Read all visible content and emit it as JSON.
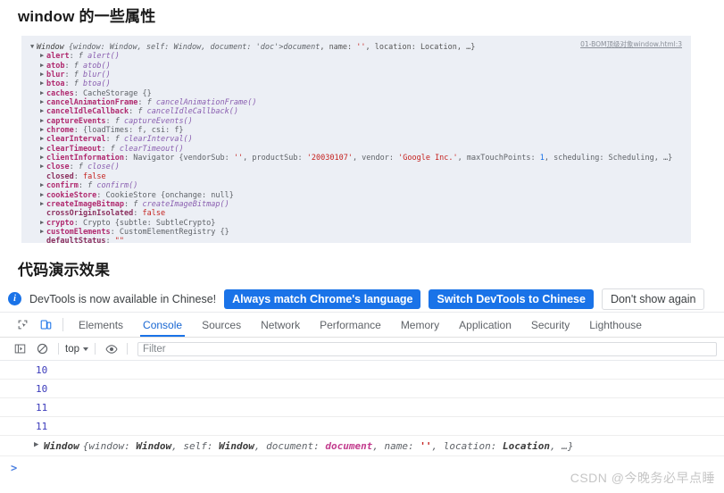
{
  "headings": {
    "first": "window 的一些属性",
    "second": "代码演示效果"
  },
  "log_block": {
    "source_link": "01-BOM顶级对象window.html:3",
    "header": {
      "ctor": "Window",
      "body": "{window: Window, self: Window, document: document, name: '', location: Location, …}"
    },
    "entries": [
      {
        "name": "alert",
        "value": "f alert()",
        "kind": "fn",
        "expandable": true
      },
      {
        "name": "atob",
        "value": "f atob()",
        "kind": "fn",
        "expandable": true
      },
      {
        "name": "blur",
        "value": "f blur()",
        "kind": "fn",
        "expandable": true
      },
      {
        "name": "btoa",
        "value": "f btoa()",
        "kind": "fn",
        "expandable": true
      },
      {
        "name": "caches",
        "value": "CacheStorage {}",
        "kind": "obj",
        "expandable": true
      },
      {
        "name": "cancelAnimationFrame",
        "value": "f cancelAnimationFrame()",
        "kind": "fn",
        "expandable": true
      },
      {
        "name": "cancelIdleCallback",
        "value": "f cancelIdleCallback()",
        "kind": "fn",
        "expandable": true
      },
      {
        "name": "captureEvents",
        "value": "f captureEvents()",
        "kind": "fn",
        "expandable": true
      },
      {
        "name": "chrome",
        "value": "{loadTimes: f, csi: f}",
        "kind": "obj",
        "expandable": true
      },
      {
        "name": "clearInterval",
        "value": "f clearInterval()",
        "kind": "fn",
        "expandable": true
      },
      {
        "name": "clearTimeout",
        "value": "f clearTimeout()",
        "kind": "fn",
        "expandable": true
      },
      {
        "name": "clientInformation",
        "value": "Navigator {vendorSub: '', productSub: '20030107', vendor: 'Google Inc.', maxTouchPoints: 1, scheduling: Scheduling, …}",
        "kind": "obj",
        "expandable": true
      },
      {
        "name": "close",
        "value": "f close()",
        "kind": "fn",
        "expandable": true
      },
      {
        "name": "closed",
        "value": "false",
        "kind": "bool",
        "expandable": false
      },
      {
        "name": "confirm",
        "value": "f confirm()",
        "kind": "fn",
        "expandable": true
      },
      {
        "name": "cookieStore",
        "value": "CookieStore {onchange: null}",
        "kind": "obj",
        "expandable": true
      },
      {
        "name": "createImageBitmap",
        "value": "f createImageBitmap()",
        "kind": "fn",
        "expandable": true
      },
      {
        "name": "crossOriginIsolated",
        "value": "false",
        "kind": "bool",
        "expandable": false
      },
      {
        "name": "crypto",
        "value": "Crypto {subtle: SubtleCrypto}",
        "kind": "obj",
        "expandable": true
      },
      {
        "name": "customElements",
        "value": "CustomElementRegistry {}",
        "kind": "obj",
        "expandable": true
      },
      {
        "name": "defaultStatus",
        "value": "\"\"",
        "kind": "str",
        "expandable": false
      }
    ]
  },
  "devtools": {
    "notification": {
      "icon": "info-icon",
      "message": "DevTools is now available in Chinese!",
      "primary_button": "Always match Chrome's language",
      "secondary_button": "Switch DevTools to Chinese",
      "dismiss_button": "Don't show again"
    },
    "tabs": [
      {
        "label": "Elements",
        "active": false
      },
      {
        "label": "Console",
        "active": true
      },
      {
        "label": "Sources",
        "active": false
      },
      {
        "label": "Network",
        "active": false
      },
      {
        "label": "Performance",
        "active": false
      },
      {
        "label": "Memory",
        "active": false
      },
      {
        "label": "Application",
        "active": false
      },
      {
        "label": "Security",
        "active": false
      },
      {
        "label": "Lighthouse",
        "active": false
      }
    ],
    "console_toolbar": {
      "context": "top",
      "filter_placeholder": "Filter"
    },
    "console_messages": [
      {
        "type": "value",
        "text": "10"
      },
      {
        "type": "value",
        "text": "10"
      },
      {
        "type": "value",
        "text": "11"
      },
      {
        "type": "value",
        "text": "11"
      }
    ],
    "console_object": {
      "ctor": "Window",
      "body": "{window: Window, self: Window, document: document, name: '', location: Location, …}"
    },
    "prompt_symbol": ">"
  },
  "watermark": "CSDN @今晚务必早点睡",
  "colors": {
    "accent": "#1a73e8",
    "code_bg": "#eceff5",
    "key": "#b02a6f",
    "string": "#c5221f",
    "number": "#1a73e8"
  }
}
